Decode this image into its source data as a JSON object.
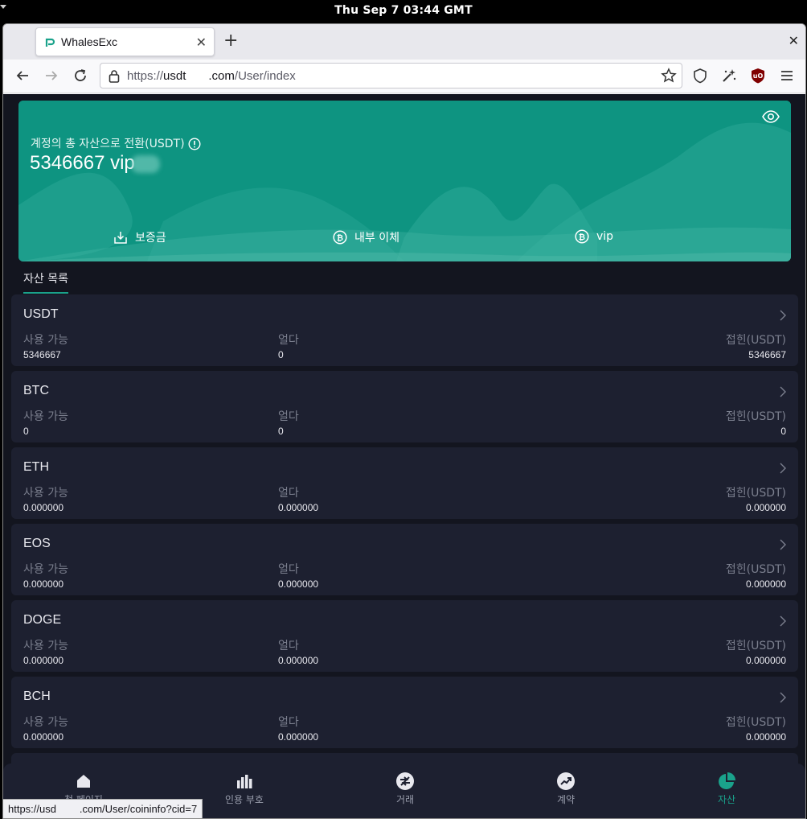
{
  "system": {
    "clock": "Thu Sep 7  03:44 GMT"
  },
  "browser": {
    "tab_title": "WhalesExc",
    "url_prefix": "https://",
    "url_host_start": "usdt",
    "url_host_end": ".com",
    "url_path": "/User/index",
    "status_url": "https://usd        .com/User/coininfo?cid=7"
  },
  "hero": {
    "label": "계정의 총 자산으로 전환(USDT)",
    "amount": "5346667 vip",
    "actions": [
      {
        "label": "보증금",
        "icon": "deposit-icon"
      },
      {
        "label": "내부 이체",
        "icon": "bitcoin-icon"
      },
      {
        "label": "vip",
        "icon": "bitcoin-icon"
      }
    ]
  },
  "asset_list": {
    "tab_label": "자산 목록",
    "col_available": "사용 가능",
    "col_frozen": "얼다",
    "col_converted": "접힌(USDT)",
    "items": [
      {
        "coin": "USDT",
        "available": "5346667",
        "frozen": "0",
        "converted": "5346667"
      },
      {
        "coin": "BTC",
        "available": "0",
        "frozen": "0",
        "converted": "0"
      },
      {
        "coin": "ETH",
        "available": "0.000000",
        "frozen": "0.000000",
        "converted": "0.000000"
      },
      {
        "coin": "EOS",
        "available": "0.000000",
        "frozen": "0.000000",
        "converted": "0.000000"
      },
      {
        "coin": "DOGE",
        "available": "0.000000",
        "frozen": "0.000000",
        "converted": "0.000000"
      },
      {
        "coin": "BCH",
        "available": "0.000000",
        "frozen": "0.000000",
        "converted": "0.000000"
      }
    ]
  },
  "bottom_nav": [
    {
      "label": "첫 페이지",
      "icon": "home-icon"
    },
    {
      "label": "인용 부호",
      "icon": "bar-chart-icon"
    },
    {
      "label": "거래",
      "icon": "exchange-icon"
    },
    {
      "label": "계약",
      "icon": "trend-icon"
    },
    {
      "label": "자산",
      "icon": "pie-chart-icon",
      "active": true
    }
  ],
  "colors": {
    "accent": "#1aa28b",
    "hero_bg": "#0e9481",
    "page_bg": "#13151f",
    "card_bg": "#1d2030"
  }
}
